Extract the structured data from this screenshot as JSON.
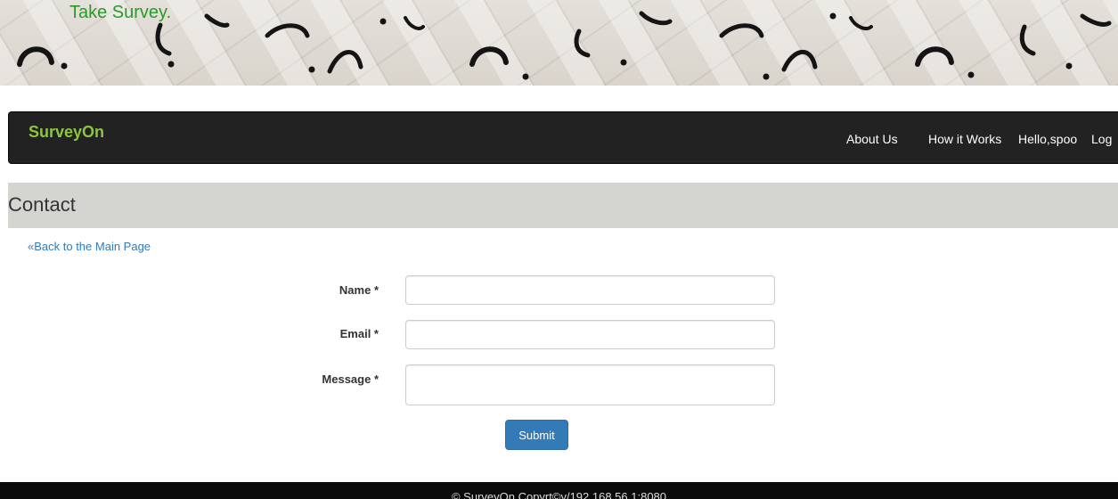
{
  "banner": {
    "text": "Take Survey."
  },
  "navbar": {
    "brand": "SurveyOn",
    "items": [
      {
        "label": "About Us"
      },
      {
        "label": "How it Works"
      },
      {
        "label": "Hello,spoo"
      },
      {
        "label": "Log"
      }
    ]
  },
  "page": {
    "title": "Contact",
    "back_link": "«Back to the Main Page"
  },
  "form": {
    "fields": [
      {
        "label": "Name *",
        "value": ""
      },
      {
        "label": "Email *",
        "value": ""
      },
      {
        "label": "Message *",
        "value": ""
      }
    ],
    "submit_label": "Submit"
  },
  "footer": {
    "text": "© SurveyOn Copyrt©y/192.168.56.1:8080"
  },
  "colors": {
    "brand": "#8cc63f",
    "navbar_bg": "#222222",
    "header_bg": "#d4d5d0",
    "link": "#337ab7",
    "button": "#337ab7",
    "banner_text": "#2a9a2a"
  }
}
